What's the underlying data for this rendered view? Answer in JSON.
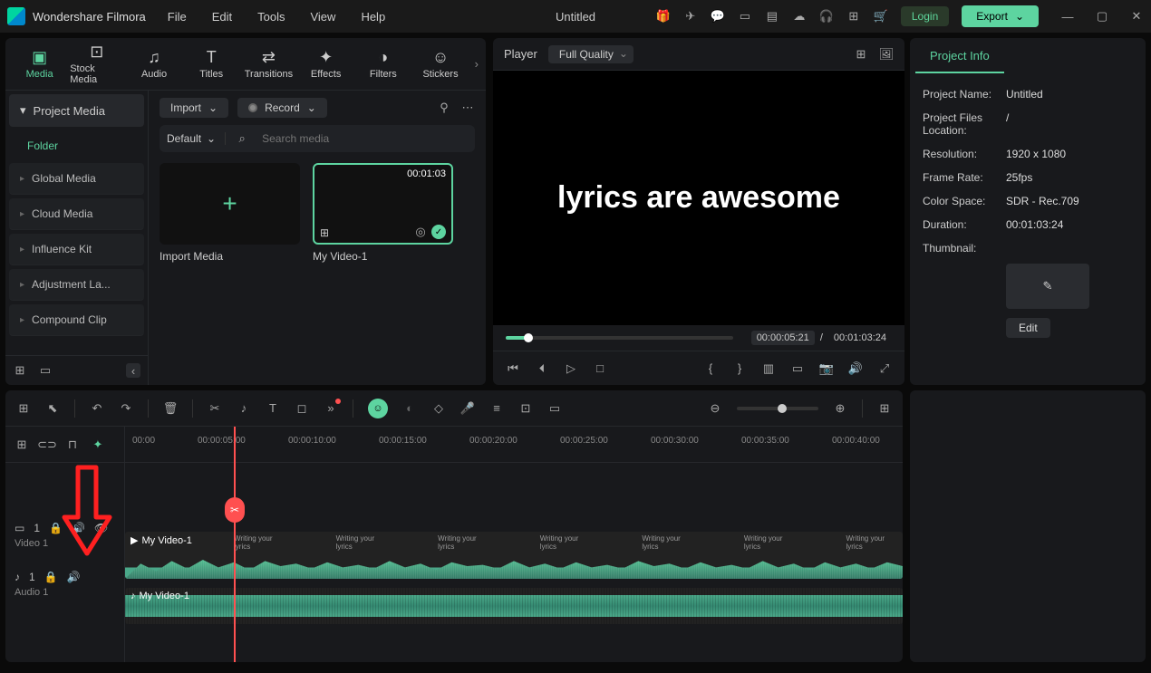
{
  "app": {
    "name": "Wondershare Filmora",
    "document": "Untitled"
  },
  "menu": [
    "File",
    "Edit",
    "Tools",
    "View",
    "Help"
  ],
  "titlebar_buttons": {
    "login": "Login",
    "export": "Export"
  },
  "tabs": [
    {
      "label": "Media",
      "active": true
    },
    {
      "label": "Stock Media"
    },
    {
      "label": "Audio"
    },
    {
      "label": "Titles"
    },
    {
      "label": "Transitions"
    },
    {
      "label": "Effects"
    },
    {
      "label": "Filters"
    },
    {
      "label": "Stickers"
    }
  ],
  "sidebar": {
    "header": "Project Media",
    "folder": "Folder",
    "items": [
      "Global Media",
      "Cloud Media",
      "Influence Kit",
      "Adjustment La...",
      "Compound Clip"
    ]
  },
  "media_toolbar": {
    "import": "Import",
    "record": "Record",
    "default": "Default",
    "search_placeholder": "Search media"
  },
  "thumbs": {
    "import_label": "Import Media",
    "clip": {
      "duration": "00:01:03",
      "name": "My Video-1"
    }
  },
  "player": {
    "label": "Player",
    "quality": "Full Quality",
    "preview_text": "lyrics are awesome",
    "current": "00:00:05:21",
    "total": "00:01:03:24",
    "separator": "/"
  },
  "info": {
    "tab": "Project Info",
    "rows": [
      {
        "k": "Project Name:",
        "v": "Untitled"
      },
      {
        "k": "Project Files Location:",
        "v": "/"
      },
      {
        "k": "Resolution:",
        "v": "1920 x 1080"
      },
      {
        "k": "Frame Rate:",
        "v": "25fps"
      },
      {
        "k": "Color Space:",
        "v": "SDR - Rec.709"
      },
      {
        "k": "Duration:",
        "v": "00:01:03:24"
      },
      {
        "k": "Thumbnail:",
        "v": ""
      }
    ],
    "edit": "Edit"
  },
  "timeline": {
    "ruler": [
      "00:00",
      "00:00:05:00",
      "00:00:10:00",
      "00:00:15:00",
      "00:00:20:00",
      "00:00:25:00",
      "00:00:30:00",
      "00:00:35:00",
      "00:00:40:00"
    ],
    "tracks": {
      "video": {
        "label": "Video 1",
        "count": "1",
        "clip": "My Video-1",
        "frame_text": "Writing your lyrics"
      },
      "audio": {
        "label": "Audio 1",
        "count": "1",
        "clip": "My Video-1"
      }
    }
  }
}
